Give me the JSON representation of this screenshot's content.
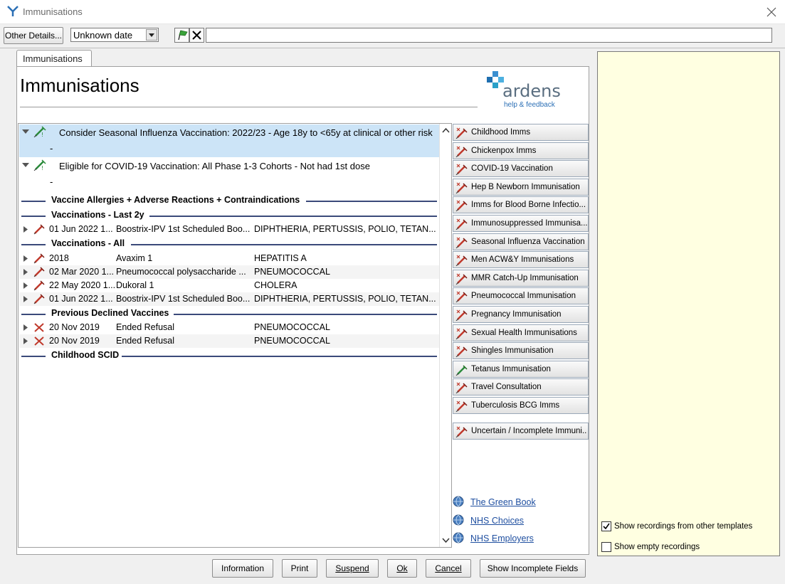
{
  "window": {
    "title": "Immunisations"
  },
  "toolbar": {
    "other_details_label": "Other Details...",
    "date_value": "Unknown date",
    "free_text_value": ""
  },
  "tab": {
    "label": "Immunisations"
  },
  "page": {
    "title": "Immunisations",
    "logo_text": "ardens",
    "logo_subtext": "help & feedback"
  },
  "alerts": [
    {
      "text": "Consider Seasonal Influenza Vaccination: 2022/23 - Age 18y to <65y at clinical or other risk",
      "detail": "-",
      "selected": true
    },
    {
      "text": "Eligible for COVID-19 Vaccination: All Phase 1-3 Cohorts - Not had 1st dose",
      "detail": "-",
      "selected": false
    }
  ],
  "sections": {
    "allergies": "Vaccine Allergies + Adverse Reactions + Contraindications",
    "last2y": "Vaccinations - Last 2y",
    "all": "Vaccinations - All",
    "declined": "Previous Declined Vaccines",
    "scid": "Childhood SCID"
  },
  "records_last2y": [
    {
      "date": "01 Jun 2022 1...",
      "name": "Boostrix-IPV 1st Scheduled Boo...",
      "value": "DIPHTHERIA, PERTUSSIS, POLIO, TETAN..."
    }
  ],
  "records_all": [
    {
      "date": "2018",
      "name": "Avaxim 1",
      "value": "HEPATITIS A"
    },
    {
      "date": "02 Mar 2020 1...",
      "name": "Pneumococcal polysaccharide ...",
      "value": "PNEUMOCOCCAL"
    },
    {
      "date": "22 May 2020 1...",
      "name": "Dukoral 1",
      "value": "CHOLERA"
    },
    {
      "date": "01 Jun 2022 1...",
      "name": "Boostrix-IPV 1st Scheduled Boo...",
      "value": "DIPHTHERIA, PERTUSSIS, POLIO, TETAN..."
    }
  ],
  "records_declined": [
    {
      "date": "20 Nov 2019",
      "name": "Ended Refusal",
      "value": "PNEUMOCOCCAL"
    },
    {
      "date": "20 Nov 2019",
      "name": "Ended Refusal",
      "value": "PNEUMOCOCCAL"
    }
  ],
  "side_buttons": [
    "Childhood Imms",
    "Chickenpox Imms",
    "COVID-19 Vaccination",
    "Hep B Newborn Immunisation",
    "Imms for Blood Borne Infectio...",
    "Immunosuppressed Immunisa...",
    "Seasonal Influenza Vaccination",
    "Men ACW&Y Immunisations",
    "MMR Catch-Up Immunisation",
    "Pneumococcal Immunisation",
    "Pregnancy Immunisation",
    "Sexual Health Immunisations",
    "Shingles Immunisation",
    "Tetanus Immunisation",
    "Travel Consultation",
    "Tuberculosis BCG Imms"
  ],
  "side_extra_button": "Uncertain / Incomplete Immuni...",
  "links": [
    "The Green Book",
    "NHS Choices",
    "NHS Employers"
  ],
  "options": {
    "show_other_templates": {
      "label": "Show recordings from other templates",
      "checked": true
    },
    "show_empty": {
      "label": "Show empty recordings",
      "checked": false
    }
  },
  "bottom_buttons": {
    "information": "Information",
    "print": "Print",
    "suspend": "Suspend",
    "ok": "Ok",
    "cancel": "Cancel",
    "show_incomplete": "Show Incomplete Fields"
  },
  "colors": {
    "selected_row": "#cce4f7",
    "notes_panel": "#ffffe1",
    "section_line": "#3b4a7a",
    "link": "#1f4fa0"
  }
}
